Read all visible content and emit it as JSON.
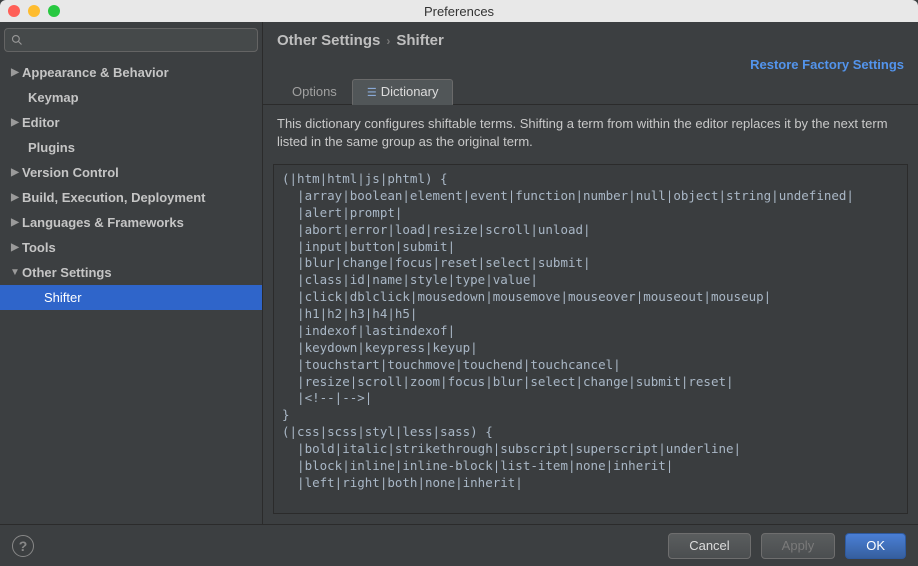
{
  "window": {
    "title": "Preferences"
  },
  "search": {
    "placeholder": ""
  },
  "sidebar": {
    "items": [
      {
        "label": "Appearance & Behavior",
        "expandable": true,
        "expanded": false
      },
      {
        "label": "Keymap",
        "expandable": false
      },
      {
        "label": "Editor",
        "expandable": true,
        "expanded": false
      },
      {
        "label": "Plugins",
        "expandable": false
      },
      {
        "label": "Version Control",
        "expandable": true,
        "expanded": false
      },
      {
        "label": "Build, Execution, Deployment",
        "expandable": true,
        "expanded": false
      },
      {
        "label": "Languages & Frameworks",
        "expandable": true,
        "expanded": false
      },
      {
        "label": "Tools",
        "expandable": true,
        "expanded": false
      },
      {
        "label": "Other Settings",
        "expandable": true,
        "expanded": true
      },
      {
        "label": "Shifter",
        "expandable": false,
        "selected": true,
        "sub": true
      }
    ]
  },
  "breadcrumb": {
    "parent": "Other Settings",
    "current": "Shifter"
  },
  "actions": {
    "restore": "Restore Factory Settings"
  },
  "tabs": {
    "options": "Options",
    "dictionary": "Dictionary",
    "active": "dictionary"
  },
  "description": "This dictionary configures shiftable terms. Shifting a term from within the editor replaces it by the next term listed in the same group as the original term.",
  "dictionary_text": "(|htm|html|js|phtml) {\n  |array|boolean|element|event|function|number|null|object|string|undefined|\n  |alert|prompt|\n  |abort|error|load|resize|scroll|unload|\n  |input|button|submit|\n  |blur|change|focus|reset|select|submit|\n  |class|id|name|style|type|value|\n  |click|dblclick|mousedown|mousemove|mouseover|mouseout|mouseup|\n  |h1|h2|h3|h4|h5|\n  |indexof|lastindexof|\n  |keydown|keypress|keyup|\n  |touchstart|touchmove|touchend|touchcancel|\n  |resize|scroll|zoom|focus|blur|select|change|submit|reset|\n  |<!--|-->|\n}\n(|css|scss|styl|less|sass) {\n  |bold|italic|strikethrough|subscript|superscript|underline|\n  |block|inline|inline-block|list-item|none|inherit|\n  |left|right|both|none|inherit|",
  "footer": {
    "help": "?",
    "cancel": "Cancel",
    "apply": "Apply",
    "ok": "OK"
  }
}
